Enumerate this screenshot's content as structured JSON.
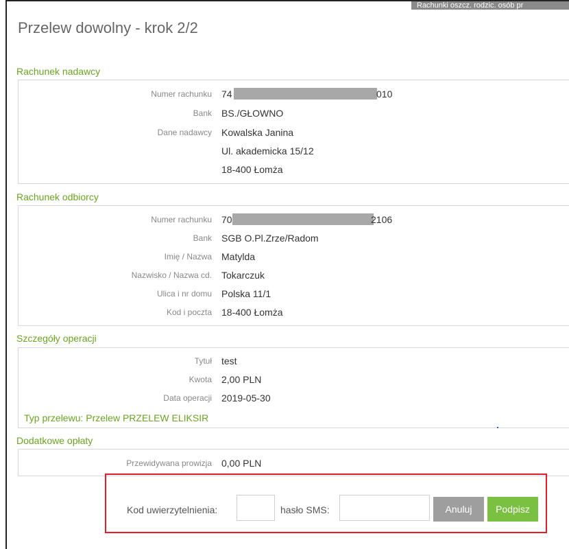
{
  "header": {
    "title": "Przelew dowolny - krok 2/2",
    "top_tab": "Rachunki oszcz. rodzic. osób pr"
  },
  "sender": {
    "section_title": "Rachunek nadawcy",
    "account_label": "Numer rachunku",
    "account_prefix": "74 8",
    "account_suffix": "010",
    "bank_label": "Bank",
    "bank": "BS./GŁOWNO",
    "data_label": "Dane nadawcy",
    "name": "Kowalska Janina",
    "street": "Ul. akademicka 15/12",
    "city": "18-400 Łomża"
  },
  "recipient": {
    "section_title": "Rachunek odbiorcy",
    "account_label": "Numer rachunku",
    "account_prefix": "70 1",
    "account_suffix": "2106",
    "bank_label": "Bank",
    "bank": "SGB O.Pl.Zrze/Radom",
    "name_label": "Imię / Nazwa",
    "name": "Matylda",
    "surname_label": "Nazwisko / Nazwa cd.",
    "surname": "Tokarczuk",
    "street_label": "Ulica i nr domu",
    "street": "Polska 11/1",
    "postal_label": "Kod i poczta",
    "postal": "18-400 Łomża"
  },
  "details": {
    "section_title": "Szczegóły operacji",
    "title_label": "Tytuł",
    "title": "test",
    "amount_label": "Kwota",
    "amount": "2,00 PLN",
    "date_label": "Data operacji",
    "date": "2019-05-30",
    "transfer_type": "Typ przelewu: Przelew PRZELEW ELIKSIR"
  },
  "fees": {
    "section_title": "Dodatkowe opłaty",
    "commission_label": "Przewidywana prowizja",
    "commission": "0,00 PLN"
  },
  "auth": {
    "code_label": "Kod uwierzytelnienia:",
    "code_value": "",
    "sms_label": "hasło SMS:",
    "sms_value": "",
    "cancel_label": "Anuluj",
    "sign_label": "Podpisz"
  },
  "colors": {
    "accent_green": "#6aa51f",
    "sign_button": "#7ac041",
    "cancel_button": "#9e9e9e",
    "highlight_border": "#e21d25"
  }
}
